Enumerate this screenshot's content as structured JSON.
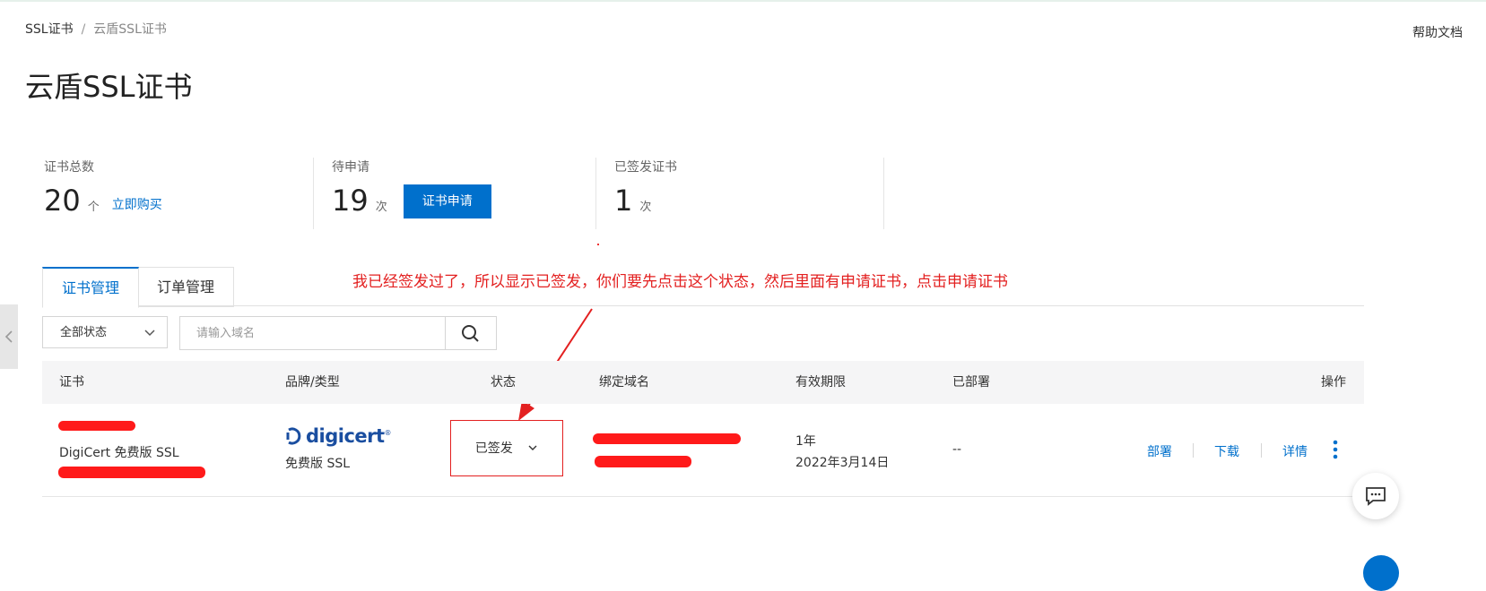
{
  "breadcrumb": {
    "root": "SSL证书",
    "separator": "/",
    "current": "云盾SSL证书"
  },
  "help": {
    "label": "帮助文档"
  },
  "page": {
    "title": "云盾SSL证书"
  },
  "stats": {
    "total": {
      "label": "证书总数",
      "value": "20",
      "unit": "个",
      "link": "立即购买"
    },
    "pending": {
      "label": "待申请",
      "value": "19",
      "unit": "次",
      "button": "证书申请"
    },
    "issued": {
      "label": "已签发证书",
      "value": "1",
      "unit": "次"
    }
  },
  "tabs": [
    {
      "label": "证书管理",
      "active": true
    },
    {
      "label": "订单管理",
      "active": false
    }
  ],
  "annotation": {
    "text": "我已经签发过了，所以显示已签发，你们要先点击这个状态，然后里面有申请证书，点击申请证书",
    "color": "#e32020"
  },
  "filter": {
    "status_selected": "全部状态",
    "search_placeholder": "请输入域名"
  },
  "table": {
    "headers": {
      "cert": "证书",
      "brand": "品牌/类型",
      "status": "状态",
      "domain": "绑定域名",
      "validity": "有效期限",
      "deployed": "已部署",
      "ops": "操作"
    },
    "rows": [
      {
        "cert_name": "DigiCert 免费版 SSL",
        "brand_logo": "digicert",
        "brand_type": "免费版 SSL",
        "status": "已签发",
        "validity_period": "1年",
        "validity_date": "2022年3月14日",
        "deployed": "--",
        "ops": {
          "deploy": "部署",
          "download": "下载",
          "detail": "详情"
        }
      }
    ]
  },
  "colors": {
    "primary": "#0070cc",
    "annotation_red": "#e32020",
    "redaction_red": "#ff1a1a"
  },
  "icons": {
    "search": "search-icon",
    "chevron": "chevron-down-icon",
    "more": "more-vertical-icon",
    "chat": "chat-icon",
    "collapse": "chevron-left-icon"
  }
}
